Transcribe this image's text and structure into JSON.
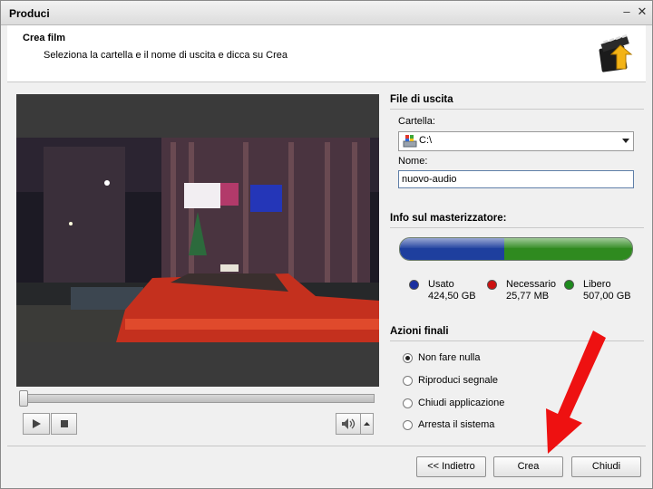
{
  "window": {
    "title": "Produci"
  },
  "header": {
    "title": "Crea film",
    "subtitle": "Seleziona la cartella e il nome di uscita e dicca su Crea",
    "logo_icon": "film-arrow-icon"
  },
  "player": {
    "play_icon": "play-icon",
    "stop_icon": "stop-icon",
    "volume_icon": "speaker-icon",
    "position": 0
  },
  "output": {
    "section_title": "File di uscita",
    "folder_label": "Cartella:",
    "folder_value": "C:\\",
    "name_label": "Nome:",
    "name_value": "nuovo-audio"
  },
  "burner": {
    "section_title": "Info sul masterizzatore:",
    "used_fraction": 0.45,
    "used_color": "#1e3f9e",
    "free_color": "#2f8a1f",
    "needed_color": "#cc1111",
    "legend": [
      {
        "label": "Usato",
        "value": "424,50 GB",
        "color": "#1a2fa0"
      },
      {
        "label": "Necessario",
        "value": "25,77 MB",
        "color": "#cc1111"
      },
      {
        "label": "Libero",
        "value": "507,00 GB",
        "color": "#1d8a1d"
      }
    ]
  },
  "final_actions": {
    "section_title": "Azioni finali",
    "options": [
      "Non fare nulla",
      "Riproduci segnale",
      "Chiudi applicazione",
      "Arresta il sistema"
    ],
    "selected": 0
  },
  "buttons": {
    "back": "<< Indietro",
    "create": "Crea",
    "close": "Chiudi"
  }
}
